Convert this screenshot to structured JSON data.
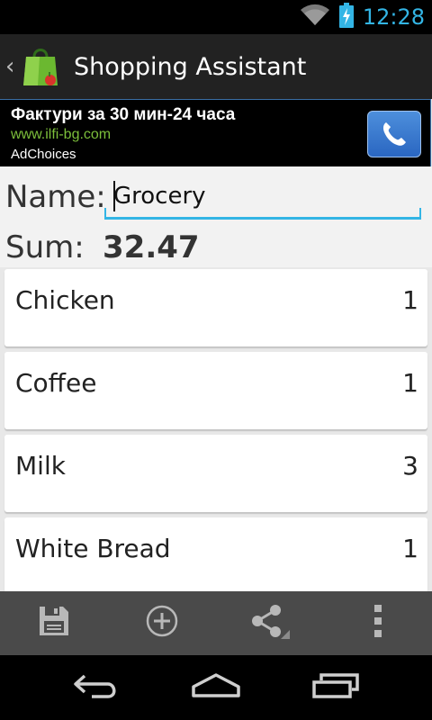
{
  "status_bar": {
    "time": "12:28",
    "wifi_icon": "wifi-icon",
    "battery_icon": "battery-charging-icon",
    "accent_color": "#33b5e5"
  },
  "action_bar": {
    "title": "Shopping Assistant",
    "back_icon": "chevron-left-icon",
    "app_icon": "shopping-bag-icon"
  },
  "ad": {
    "title": "Фактури за 30 мин-24 часа",
    "url": "www.ilfi-bg.com",
    "choices_label": "AdChoices",
    "call_icon": "phone-icon"
  },
  "form": {
    "name_label": "Name:",
    "name_value": "Grocery",
    "sum_label": "Sum:",
    "sum_value": "32.47"
  },
  "items": [
    {
      "name": "Chicken",
      "qty": "1"
    },
    {
      "name": "Coffee",
      "qty": "1"
    },
    {
      "name": "Milk",
      "qty": "3"
    },
    {
      "name": "White Bread",
      "qty": "1"
    }
  ],
  "toolbar": {
    "actions": [
      "save-icon",
      "add-icon",
      "share-icon",
      "overflow-menu-icon"
    ]
  },
  "nav_bar": {
    "buttons": [
      "back-icon",
      "home-icon",
      "recent-apps-icon"
    ]
  }
}
